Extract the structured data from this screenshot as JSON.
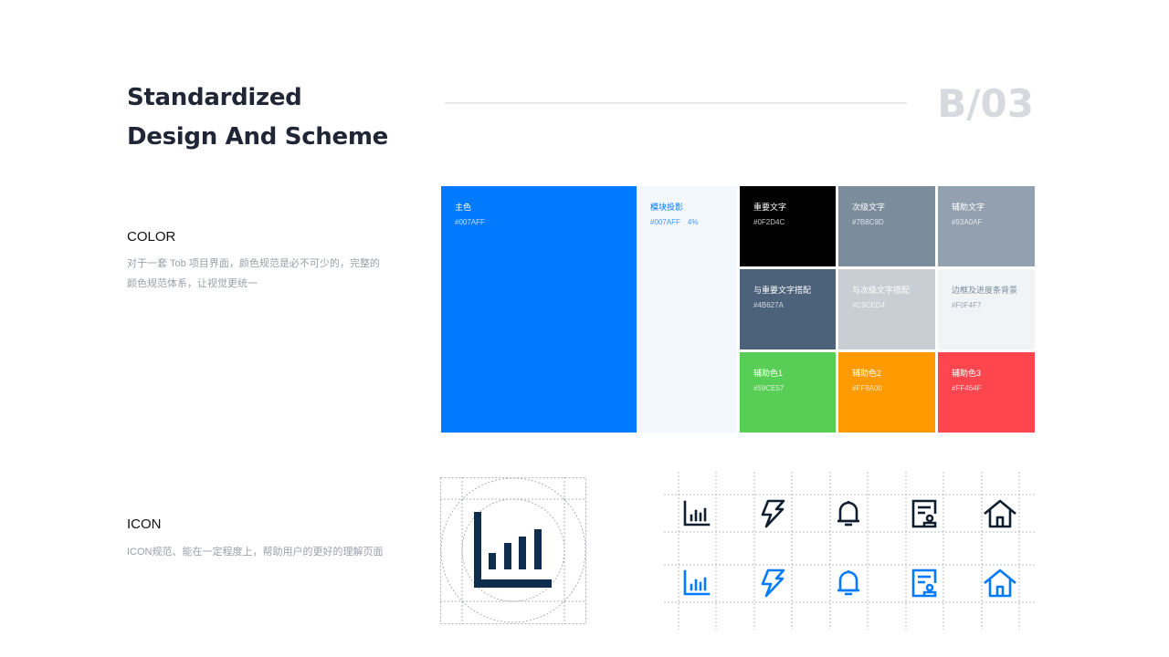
{
  "header": {
    "title_line1": "Standardized",
    "title_line2": "Design And Scheme",
    "page_number": "B/03"
  },
  "color_section": {
    "title": "COLOR",
    "description": "对于一套 Tob 项目界面，颜色规范是必不可少的，完整的颜色规范体系，让视觉更统一"
  },
  "icon_section": {
    "title": "ICON",
    "description": "ICON规范、能在一定程度上，帮助用户的更好的理解页面"
  },
  "swatches": {
    "primary": {
      "name": "主色",
      "hex": "#007AFF",
      "color": "#007AFF"
    },
    "shadow": {
      "name": "模块投影",
      "hex": "#007AFF",
      "alpha": "4%",
      "color": "#F3F8FE"
    },
    "text_main": {
      "name": "重要文字",
      "hex": "#0F2D4C",
      "color": "#000000"
    },
    "text_sec": {
      "name": "次级文字",
      "hex": "#7B8C9D",
      "color": "#7B8C9D"
    },
    "text_aux": {
      "name": "辅助文字",
      "hex": "#93A0AF",
      "color": "#93A0AF"
    },
    "pair_main": {
      "name": "与重要文字搭配",
      "hex": "#4B627A",
      "color": "#4B627A"
    },
    "pair_sec": {
      "name": "与次级文字搭配",
      "hex": "#C9CED4",
      "color": "#C9CED4"
    },
    "border": {
      "name": "边框及进度条背景",
      "hex": "#F0F4F7",
      "color": "#F0F4F7"
    },
    "aux1": {
      "name": "辅助色1",
      "hex": "#59CE57",
      "color": "#59CE57"
    },
    "aux2": {
      "name": "辅助色2",
      "hex": "#FF9A00",
      "color": "#FF9A00"
    },
    "aux3": {
      "name": "辅助色3",
      "hex": "#FF464F",
      "color": "#FF464F"
    }
  },
  "icons": {
    "dark_color": "#0F1E2E",
    "blue_color": "#007AFF",
    "featured_color": "#0F2D4C",
    "set": [
      "bar-chart-icon",
      "lightning-icon",
      "bell-icon",
      "document-icon",
      "home-icon"
    ]
  }
}
